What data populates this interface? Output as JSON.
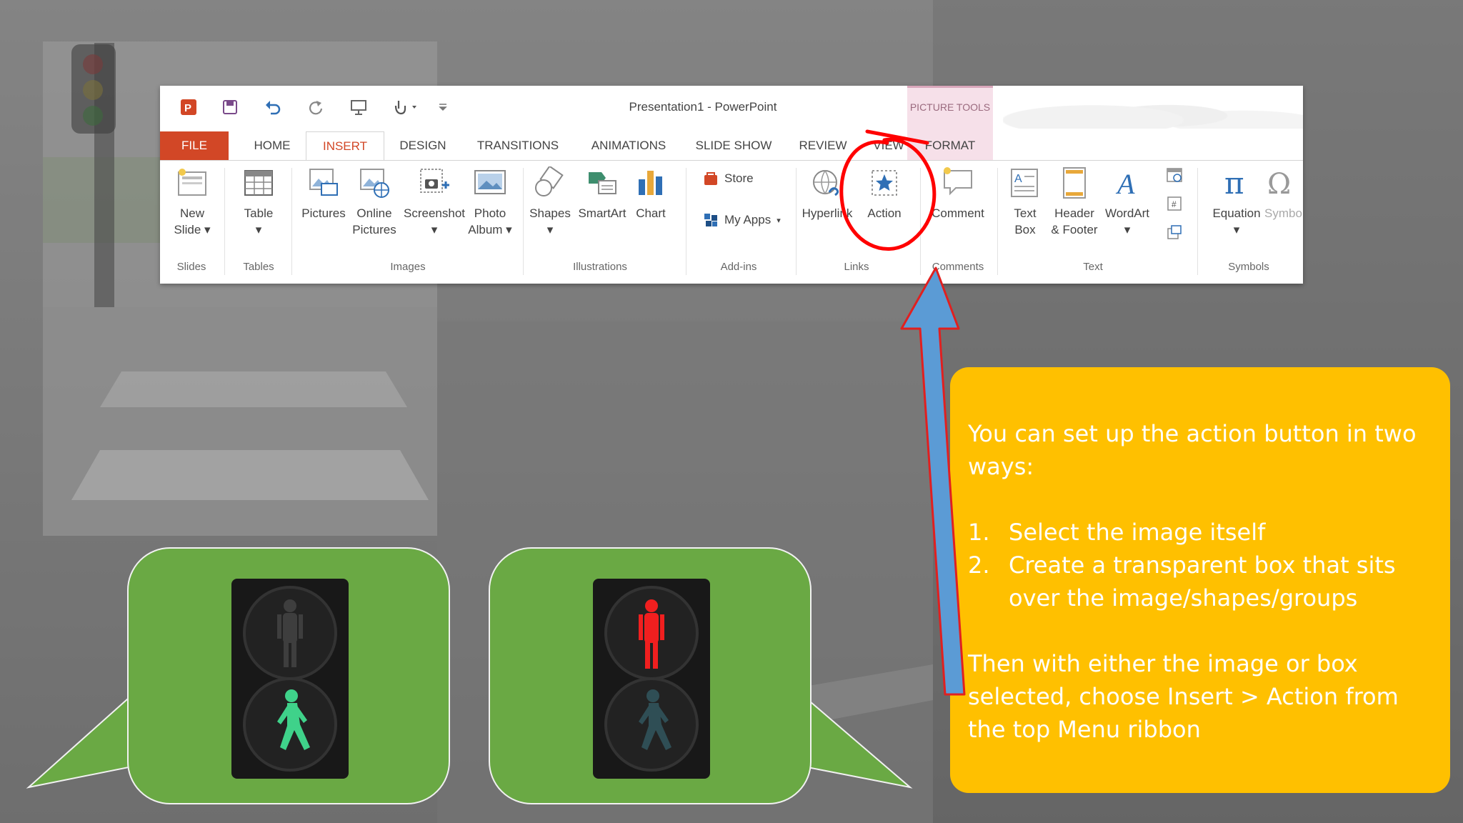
{
  "app": {
    "window_title": "Presentation1 - PowerPoint",
    "contextual_tab_group": "PICTURE TOOLS"
  },
  "qat": [
    {
      "icon": "powerpoint-logo-icon"
    },
    {
      "icon": "save-icon"
    },
    {
      "icon": "undo-icon"
    },
    {
      "icon": "redo-icon"
    },
    {
      "icon": "start-from-beginning-icon"
    },
    {
      "icon": "touch-mode-icon"
    },
    {
      "icon": "customize-qat-icon"
    }
  ],
  "tabs": [
    "FILE",
    "HOME",
    "INSERT",
    "DESIGN",
    "TRANSITIONS",
    "ANIMATIONS",
    "SLIDE SHOW",
    "REVIEW",
    "VIEW",
    "FORMAT"
  ],
  "active_tab": "INSERT",
  "groups": {
    "slides": {
      "label": "Slides",
      "buttons": [
        {
          "label": "New\nSlide ▾",
          "icon": "new-slide-icon"
        }
      ]
    },
    "tables": {
      "label": "Tables",
      "buttons": [
        {
          "label": "Table\n▾",
          "icon": "table-icon"
        }
      ]
    },
    "images": {
      "label": "Images",
      "buttons": [
        {
          "label": "Pictures",
          "icon": "pictures-icon"
        },
        {
          "label": "Online\nPictures",
          "icon": "online-pictures-icon"
        },
        {
          "label": "Screenshot\n▾",
          "icon": "screenshot-icon"
        },
        {
          "label": "Photo\nAlbum ▾",
          "icon": "photo-album-icon"
        }
      ]
    },
    "illustrations": {
      "label": "Illustrations",
      "buttons": [
        {
          "label": "Shapes\n▾",
          "icon": "shapes-icon"
        },
        {
          "label": "SmartArt",
          "icon": "smartart-icon"
        },
        {
          "label": "Chart",
          "icon": "chart-icon"
        }
      ]
    },
    "addins": {
      "label": "Add-ins",
      "buttons": [
        {
          "label": "Store",
          "icon": "store-icon"
        },
        {
          "label": "My Apps",
          "icon": "my-apps-icon"
        }
      ]
    },
    "links": {
      "label": "Links",
      "buttons": [
        {
          "label": "Hyperlink",
          "icon": "hyperlink-icon"
        },
        {
          "label": "Action",
          "icon": "action-icon"
        }
      ]
    },
    "comments": {
      "label": "Comments",
      "buttons": [
        {
          "label": "Comment",
          "icon": "comment-icon"
        }
      ]
    },
    "text": {
      "label": "Text",
      "buttons": [
        {
          "label": "Text\nBox",
          "icon": "text-box-icon"
        },
        {
          "label": "Header\n& Footer",
          "icon": "header-footer-icon"
        },
        {
          "label": "WordArt\n▾",
          "icon": "wordart-icon"
        }
      ]
    },
    "symbols": {
      "label": "Symbols",
      "buttons": [
        {
          "label": "Equation\n▾",
          "icon": "equation-icon"
        },
        {
          "label": "Symbol",
          "icon": "symbol-icon"
        }
      ]
    }
  },
  "callouts": [
    {
      "name": "green-man-callout",
      "signal": "walk",
      "color": "#6aa944"
    },
    {
      "name": "red-man-callout",
      "signal": "stop",
      "color": "#6aa944"
    }
  ],
  "instructions": {
    "intro": "You can set up the action button in two ways:",
    "steps": [
      {
        "num": "1.",
        "text": "Select the image itself"
      },
      {
        "num": "2.",
        "text": "Create a transparent box that sits over the image/shapes/groups"
      }
    ],
    "outro": "Then with either the image or box selected, choose Insert > Action from the top Menu ribbon"
  },
  "colors": {
    "file_tab": "#d24726",
    "instruction_box": "#ffc000",
    "callout": "#6aa944",
    "arrow": "#5b9bd5",
    "arrow_outline": "#e02020",
    "highlight_circle": "#ff0000"
  }
}
